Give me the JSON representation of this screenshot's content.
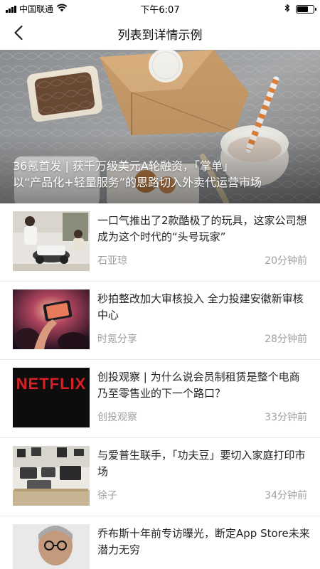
{
  "status_bar": {
    "carrier": "中国联通",
    "time": "下午6:07",
    "battery_level": 0.7
  },
  "nav": {
    "title": "列表到详情示例"
  },
  "banner": {
    "caption_line1": "36氪首发 | 获千万级美元A轮融资，「掌单」",
    "caption_line2": "以“产品化+轻量服务”的思路切入外卖代运营市场"
  },
  "news": [
    {
      "title": "一口气推出了2款酷极了的玩具，这家公司想成为这个时代的“头号玩家”",
      "source": "石亚琼",
      "time": "20分钟前"
    },
    {
      "title": "秒拍整改加大审核投入 全力投建安徽新审核中心",
      "source": "时氪分享",
      "time": "28分钟前"
    },
    {
      "title": "创投观察 | 为什么说会员制租赁是整个电商乃至零售业的下一个路口？",
      "source": "创投观察",
      "time": "33分钟前"
    },
    {
      "title": "与爱普生联手，「功夫豆」要切入家庭打印市场",
      "source": "徐子",
      "time": "34分钟前"
    },
    {
      "title": "乔布斯十年前专访曝光，断定App Store未来潜力无穷",
      "source": "",
      "time": ""
    }
  ],
  "thumb_labels": {
    "netflix": "NETFLIX"
  }
}
